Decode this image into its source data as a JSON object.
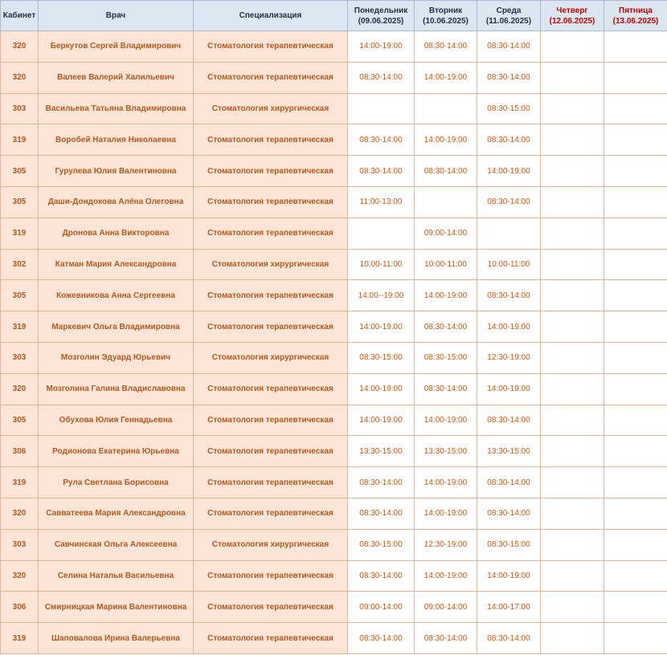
{
  "headers": {
    "cabinet": "Кабинет",
    "doctor": "Врач",
    "specialization": "Специализация",
    "mon": {
      "name": "Понедельник",
      "date": "(09.06.2025)"
    },
    "tue": {
      "name": "Вторник",
      "date": "(10.06.2025)"
    },
    "wed": {
      "name": "Среда",
      "date": "(11.06.2025)"
    },
    "thu": {
      "name": "Четверг",
      "date": "(12.06.2025)"
    },
    "fri": {
      "name": "Пятница",
      "date": "(13.06.2025)"
    }
  },
  "colors": {
    "header_bg": "#dce6f1",
    "header_text": "#1f2f4a",
    "highlight_text": "#c00000",
    "row_bg": "#fce4d6",
    "row_text": "#b35a1f",
    "time_text": "#c55a11"
  },
  "rows": [
    {
      "cab": "320",
      "doctor": "Беркутов Сергей Владимирович",
      "spec": "Стоматология терапевтическая",
      "mon": "14:00-19:00",
      "tue": "08:30-14:00",
      "wed": "08:30-14:00",
      "thu": "",
      "fri": ""
    },
    {
      "cab": "320",
      "doctor": "Валеев Валерий Халильевич",
      "spec": "Стоматология терапевтическая",
      "mon": "08:30-14:00",
      "tue": "14:00-19:00",
      "wed": "08:30-14:00",
      "thu": "",
      "fri": ""
    },
    {
      "cab": "303",
      "doctor": "Васильева Татьяна Владимировна",
      "spec": "Стоматология хирургическая",
      "mon": "",
      "tue": "",
      "wed": "08:30-15:00",
      "thu": "",
      "fri": ""
    },
    {
      "cab": "319",
      "doctor": "Воробей Наталия Николаевна",
      "spec": "Стоматология терапевтическая",
      "mon": "08:30-14:00",
      "tue": "14:00-19:00",
      "wed": "08:30-14:00",
      "thu": "",
      "fri": ""
    },
    {
      "cab": "305",
      "doctor": "Гурулева Юлия Валентиновна",
      "spec": "Стоматология терапевтическая",
      "mon": "08:30-14:00",
      "tue": "08:30-14:00",
      "wed": "14:00-19:00",
      "thu": "",
      "fri": ""
    },
    {
      "cab": "305",
      "doctor": "Даши-Дондокова Алёна Олеговна",
      "spec": "Стоматология терапевтическая",
      "mon": "11:00-13:00",
      "tue": "",
      "wed": "08:30-14:00",
      "thu": "",
      "fri": ""
    },
    {
      "cab": "319",
      "doctor": "Дронова Анна Викторовна",
      "spec": "Стоматология терапевтическая",
      "mon": "",
      "tue": "09:00-14:00",
      "wed": "",
      "thu": "",
      "fri": ""
    },
    {
      "cab": "302",
      "doctor": "Катман Мария Александровна",
      "spec": "Стоматология хирургическая",
      "mon": "10:00-11:00",
      "tue": "10:00-11:00",
      "wed": "10:00-11:00",
      "thu": "",
      "fri": ""
    },
    {
      "cab": "305",
      "doctor": "Кожевникова Анна Сергеевна",
      "spec": "Стоматология терапевтическая",
      "mon": "14:00--19:00",
      "tue": "14:00-19:00",
      "wed": "08:30-14:00",
      "thu": "",
      "fri": ""
    },
    {
      "cab": "319",
      "doctor": "Маркевич Ольга Владимировна",
      "spec": "Стоматология терапевтическая",
      "mon": "14:00-19:00",
      "tue": "08:30-14:00",
      "wed": "14:00-19:00",
      "thu": "",
      "fri": ""
    },
    {
      "cab": "303",
      "doctor": "Мозголин Эдуард Юрьевич",
      "spec": "Стоматология хирургическая",
      "mon": "08:30-15:00",
      "tue": "08:30-15:00",
      "wed": "12:30-19:00",
      "thu": "",
      "fri": ""
    },
    {
      "cab": "320",
      "doctor": "Мозголина Галина Владиславовна",
      "spec": "Стоматология терапевтическая",
      "mon": "14:00-19:00",
      "tue": "08:30-14:00",
      "wed": "14:00-19:00",
      "thu": "",
      "fri": ""
    },
    {
      "cab": "305",
      "doctor": "Обухова Юлия Геннадьевна",
      "spec": "Стоматология терапевтическая",
      "mon": "14:00-19:00",
      "tue": "14:00-19:00",
      "wed": "08:30-14:00",
      "thu": "",
      "fri": ""
    },
    {
      "cab": "306",
      "doctor": "Родионова Екатерина Юрьевна",
      "spec": "Стоматология терапевтическая",
      "mon": "13:30-15:00",
      "tue": "13:30-15:00",
      "wed": "13:30-15:00",
      "thu": "",
      "fri": ""
    },
    {
      "cab": "319",
      "doctor": "Рула Светлана Борисовна",
      "spec": "Стоматология терапевтическая",
      "mon": "08:30-14:00",
      "tue": "14:00-19:00",
      "wed": "08:30-14:00",
      "thu": "",
      "fri": ""
    },
    {
      "cab": "320",
      "doctor": "Савватеева Мария Александровна",
      "spec": "Стоматология терапевтическая",
      "mon": "08:30-14:00",
      "tue": "14:00-19:00",
      "wed": "08:30-14:00",
      "thu": "",
      "fri": ""
    },
    {
      "cab": "303",
      "doctor": "Савчинская Ольга Алексеевна",
      "spec": "Стоматология хирургическая",
      "mon": "08:30-15:00",
      "tue": "12:30-19:00",
      "wed": "08:30-15:00",
      "thu": "",
      "fri": ""
    },
    {
      "cab": "320",
      "doctor": "Селина Наталья Васильевна",
      "spec": "Стоматология терапевтическая",
      "mon": "08:30-14:00",
      "tue": "14:00-19:00",
      "wed": "14:00-19:00",
      "thu": "",
      "fri": ""
    },
    {
      "cab": "306",
      "doctor": "Смирницкая Марина Валентиновна",
      "spec": "Стоматология терапевтическая",
      "mon": "09:00-14:00",
      "tue": "09:00-14:00",
      "wed": "14:00-17:00",
      "thu": "",
      "fri": ""
    },
    {
      "cab": "319",
      "doctor": "Шаповалова Ирина Валерьевна",
      "spec": "Стоматология терапевтическая",
      "mon": "08:30-14:00",
      "tue": "08:30-14:00",
      "wed": "08:30-14:00",
      "thu": "",
      "fri": ""
    }
  ]
}
